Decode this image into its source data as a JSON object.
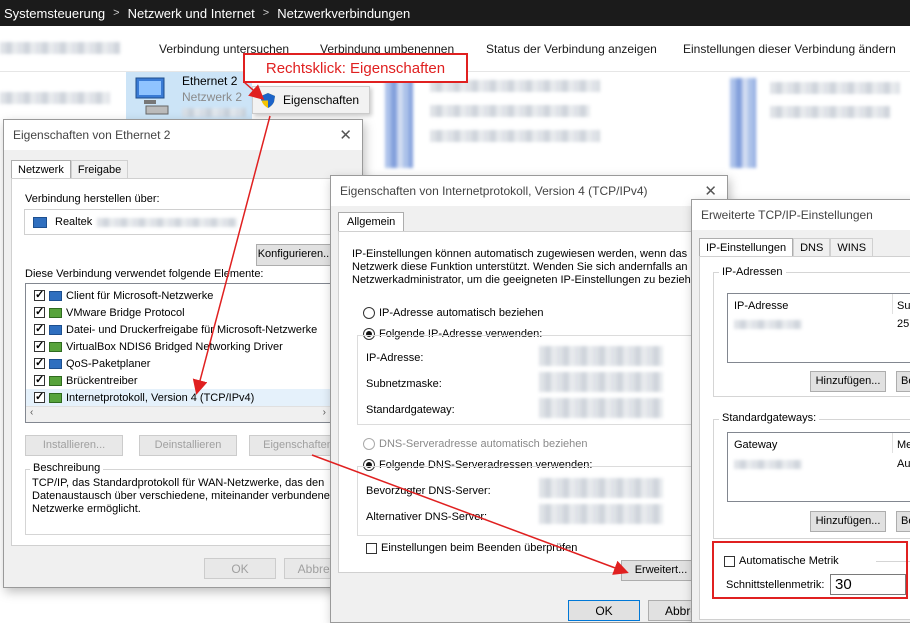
{
  "breadcrumb": {
    "items": [
      "Systemsteuerung",
      "Netzwerk und Internet",
      "Netzwerkverbindungen"
    ],
    "separator": ">"
  },
  "commandbar": {
    "items": [
      "Verbindung untersuchen",
      "Verbindung umbenennen",
      "Status der Verbindung anzeigen",
      "Einstellungen dieser Verbindung ändern"
    ]
  },
  "adapter": {
    "name": "Ethernet 2",
    "network": "Netzwerk 2"
  },
  "callout": {
    "text": "Rechtsklick: Eigenschaften"
  },
  "context_menu": {
    "item": "Eigenschaften"
  },
  "ethernet_props": {
    "title": "Eigenschaften von Ethernet 2",
    "tabs": [
      "Netzwerk",
      "Freigabe"
    ],
    "connect_via_label": "Verbindung herstellen über:",
    "adapter_name": "Realtek",
    "configure_button": "Konfigurieren...",
    "elements_label": "Diese Verbindung verwendet folgende Elemente:",
    "elements": [
      "Client für Microsoft-Netzwerke",
      "VMware Bridge Protocol",
      "Datei- und Druckerfreigabe für Microsoft-Netzwerke",
      "VirtualBox NDIS6 Bridged Networking Driver",
      "QoS-Paketplaner",
      "Brückentreiber",
      "Internetprotokoll, Version 4 (TCP/IPv4)"
    ],
    "install_button": "Installieren...",
    "uninstall_button": "Deinstallieren",
    "properties_button": "Eigenschaften",
    "description_label": "Beschreibung",
    "description_text": [
      "TCP/IP, das Standardprotokoll für WAN-Netzwerke, das den",
      "Datenaustausch über verschiedene, miteinander verbundene",
      "Netzwerke ermöglicht."
    ],
    "ok_button": "OK",
    "cancel_button": "Abbrech"
  },
  "ipv4_props": {
    "title": "Eigenschaften von Internetprotokoll, Version 4 (TCP/IPv4)",
    "tab": "Allgemein",
    "intro": [
      "IP-Einstellungen können automatisch zugewiesen werden, wenn das",
      "Netzwerk diese Funktion unterstützt. Wenden Sie sich andernfalls an de",
      "Netzwerkadministrator, um die geeigneten IP-Einstellungen zu beziehe"
    ],
    "auto_ip": "IP-Adresse automatisch beziehen",
    "manual_ip": "Folgende IP-Adresse verwenden:",
    "ip_label": "IP-Adresse:",
    "subnet_label": "Subnetzmaske:",
    "gateway_label": "Standardgateway:",
    "auto_dns": "DNS-Serveradresse automatisch beziehen",
    "manual_dns": "Folgende DNS-Serveradressen verwenden:",
    "preferred_dns": "Bevorzugter DNS-Server:",
    "alternate_dns": "Alternativer DNS-Server:",
    "validate": "Einstellungen beim Beenden überprüfen",
    "advanced_button": "Erweitert...",
    "ok_button": "OK",
    "cancel_button": "Abbrec"
  },
  "advanced": {
    "title": "Erweiterte TCP/IP-Einstellungen",
    "tabs": [
      "IP-Einstellungen",
      "DNS",
      "WINS"
    ],
    "ip_group": "IP-Adressen",
    "ip_col1": "IP-Adresse",
    "ip_col2": "Sub",
    "ip_val2": "25",
    "add_button": "Hinzufügen...",
    "edit_button": "Be",
    "gw_group": "Standardgateways:",
    "gw_col1": "Gateway",
    "gw_col2": "Me",
    "gw_val2": "Au",
    "auto_metric": "Automatische Metrik",
    "metric_label": "Schnittstellenmetrik:",
    "metric_value": "30"
  },
  "colors": {
    "accent": "#0078d7",
    "annotation": "#e02020"
  }
}
